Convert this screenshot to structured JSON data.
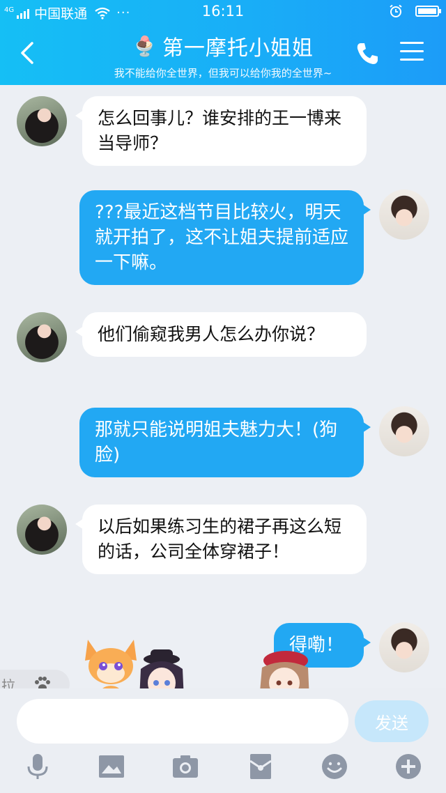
{
  "status_bar": {
    "network": "4G",
    "carrier": "中国联通",
    "dots": "···",
    "time": "16:11"
  },
  "header": {
    "title_emoji": "🍨",
    "title": "第一摩托小姐姐",
    "subtitle": "我不能给你全世界，但我可以给你我的全世界~"
  },
  "messages": [
    {
      "side": "left",
      "text": "怎么回事儿？谁安排的王一博来当导师？"
    },
    {
      "side": "right",
      "text": "???最近这档节目比较火，明天就开拍了，这不让姐夫提前适应一下嘛。"
    },
    {
      "side": "left",
      "text": "他们偷窥我男人怎么办你说？"
    },
    {
      "side": "right",
      "text": "那就只能说明姐夫魅力大！(狗脸)"
    },
    {
      "side": "left",
      "text": "以后如果练习生的裙子再这么短的话，公司全体穿裙子！"
    },
    {
      "side": "right",
      "text": "得嘞！"
    }
  ],
  "pull_tab": {
    "label": "拉"
  },
  "input": {
    "value": "",
    "placeholder": ""
  },
  "send_label": "发送",
  "colors": {
    "header_gradient_start": "#15bff5",
    "header_gradient_end": "#1c9cf8",
    "bubble_sent": "#22a8f3",
    "bubble_received": "#ffffff",
    "background": "#eceff4",
    "send_button": "#c6e7fb",
    "toolbar_icon": "#8e97a6"
  },
  "icons": {
    "back": "chevron-left-icon",
    "phone": "phone-icon",
    "menu": "hamburger-menu-icon",
    "toolbar": [
      "microphone-icon",
      "image-icon",
      "camera-icon",
      "red-packet-icon",
      "emoji-icon",
      "plus-icon"
    ]
  }
}
